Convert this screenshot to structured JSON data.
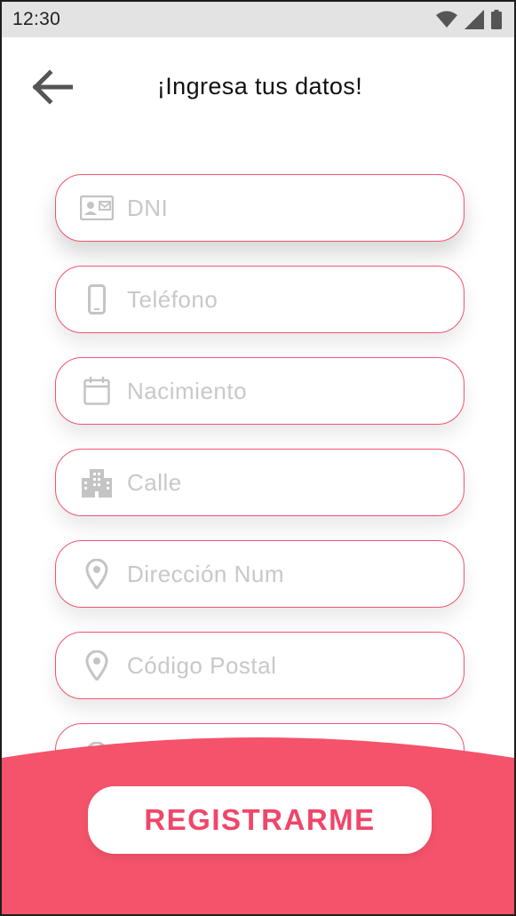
{
  "status_bar": {
    "time": "12:30",
    "icons": [
      "wifi-icon",
      "signal-icon",
      "battery-icon"
    ]
  },
  "header": {
    "title": "¡Ingresa tus datos!",
    "back_icon": "arrow-left-icon"
  },
  "form": {
    "fields": [
      {
        "placeholder": "DNI",
        "value": "",
        "icon": "id-card-icon"
      },
      {
        "placeholder": "Teléfono",
        "value": "",
        "icon": "phone-icon"
      },
      {
        "placeholder": "Nacimiento",
        "value": "",
        "icon": "calendar-icon"
      },
      {
        "placeholder": "Calle",
        "value": "",
        "icon": "building-icon"
      },
      {
        "placeholder": "Dirección Num",
        "value": "",
        "icon": "location-pin-icon"
      },
      {
        "placeholder": "Código Postal",
        "value": "",
        "icon": "location-pin-icon"
      },
      {
        "placeholder": "",
        "value": "",
        "icon": "location-pin-icon"
      }
    ]
  },
  "actions": {
    "register_label": "REGISTRARME"
  },
  "colors": {
    "accent": "#f0466a",
    "field_border": "#f0556f",
    "status_bar_bg": "#e3e3e3",
    "placeholder": "#c8c8c8"
  }
}
